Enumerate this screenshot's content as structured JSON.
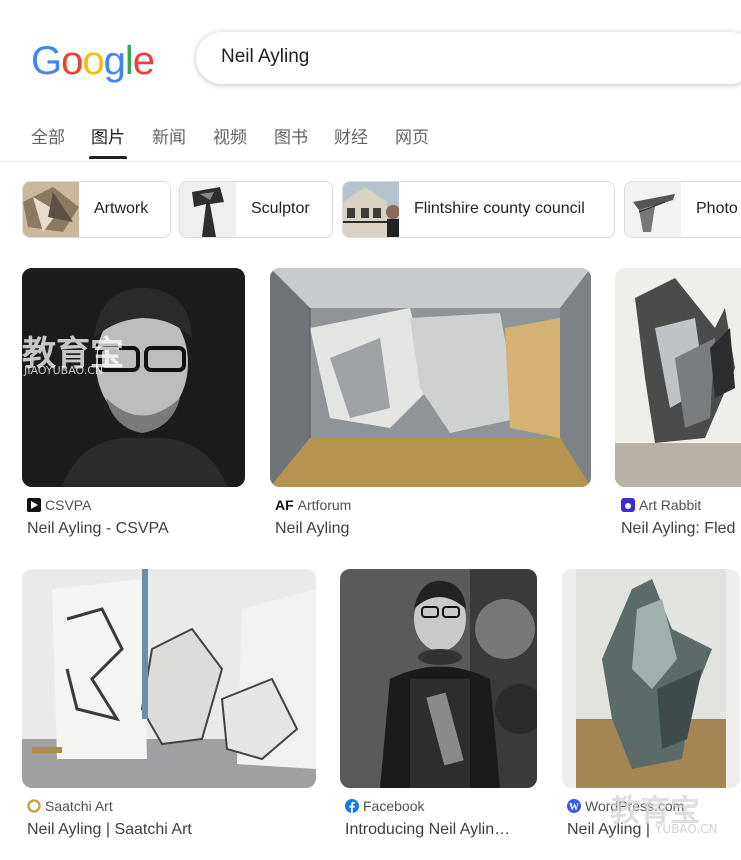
{
  "search": {
    "query": "Neil Ayling"
  },
  "logo": {
    "letters": [
      "G",
      "o",
      "o",
      "g",
      "l",
      "e"
    ]
  },
  "tabs": [
    {
      "label": "全部"
    },
    {
      "label": "图片"
    },
    {
      "label": "新闻"
    },
    {
      "label": "视频"
    },
    {
      "label": "图书"
    },
    {
      "label": "财经"
    },
    {
      "label": "网页"
    }
  ],
  "chips": [
    {
      "label": "Artwork"
    },
    {
      "label": "Sculptor"
    },
    {
      "label": "Flintshire county council"
    },
    {
      "label": "Photo"
    }
  ],
  "results": [
    {
      "source": "CSVPA",
      "title": "Neil Ayling - CSVPA"
    },
    {
      "source": "Artforum",
      "title": "Neil Ayling"
    },
    {
      "source": "Art Rabbit",
      "title": "Neil Ayling: Fled"
    },
    {
      "source": "Saatchi Art",
      "title": "Neil Ayling | Saatchi Art"
    },
    {
      "source": "Facebook",
      "title": "Introducing Neil Aylin…"
    },
    {
      "source": "WordPress.com",
      "title": "Neil Ayling |"
    }
  ],
  "watermark": {
    "cn": "教育宝",
    "url": "JIAOYUBAO.CN",
    "url2": "YUBAO.CN"
  },
  "colors": {
    "blue": "#4285F4",
    "red": "#EA4335",
    "yellow": "#FBBC05",
    "green": "#34A853"
  }
}
